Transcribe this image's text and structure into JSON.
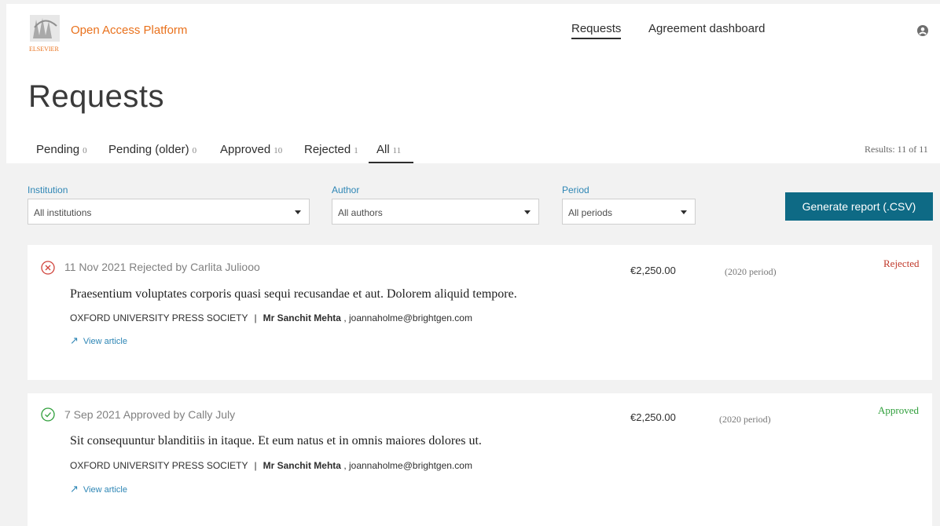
{
  "header": {
    "brand": "Open Access Platform",
    "logo_name": "ELSEVIER",
    "nav": {
      "requests": "Requests",
      "dashboard": "Agreement dashboard"
    },
    "user_icon": "user-icon"
  },
  "page": {
    "title": "Requests"
  },
  "tabs": [
    {
      "label": "Pending",
      "count": "0"
    },
    {
      "label": "Pending (older)",
      "count": "0"
    },
    {
      "label": "Approved",
      "count": "10"
    },
    {
      "label": "Rejected",
      "count": "1"
    },
    {
      "label": "All",
      "count": "11",
      "active": true
    }
  ],
  "results": "Results: 11 of 11",
  "filters": {
    "institution": {
      "label": "Institution",
      "value": "All institutions"
    },
    "author": {
      "label": "Author",
      "value": "All authors"
    },
    "period": {
      "label": "Period",
      "value": "All periods"
    }
  },
  "generate_button": "Generate report (.CSV)",
  "requests": [
    {
      "meta": "11 Nov 2021 Rejected by Carlita Juliooo",
      "price": "€2,250.00",
      "period": "(2020 period)",
      "status": "Rejected",
      "status_icon": "x-circle-icon",
      "status_color": "#c0392b",
      "title": "Praesentium voluptates corporis quasi sequi recusandae et aut. Dolorem aliquid tempore.",
      "publisher": "OXFORD UNIVERSITY PRESS SOCIETY",
      "separator": "|",
      "author": "Mr Sanchit Mehta",
      "email": ", joannaholme@brightgen.com",
      "link": "View article"
    },
    {
      "meta": "7 Sep 2021 Approved by Cally July",
      "price": "€2,250.00",
      "period": "(2020 period)",
      "status": "Approved",
      "status_icon": "check-circle-icon",
      "status_color": "#2e9e3a",
      "title": "Sit consequuntur blanditiis in itaque. Et eum natus et in omnis maiores dolores ut.",
      "publisher": "OXFORD UNIVERSITY PRESS SOCIETY",
      "separator": "|",
      "author": "Mr Sanchit Mehta",
      "email": ", joannaholme@brightgen.com",
      "link": "View article"
    }
  ],
  "colors": {
    "brand": "#e9711c",
    "accent": "#0e6a85",
    "link": "#2e86b5"
  }
}
